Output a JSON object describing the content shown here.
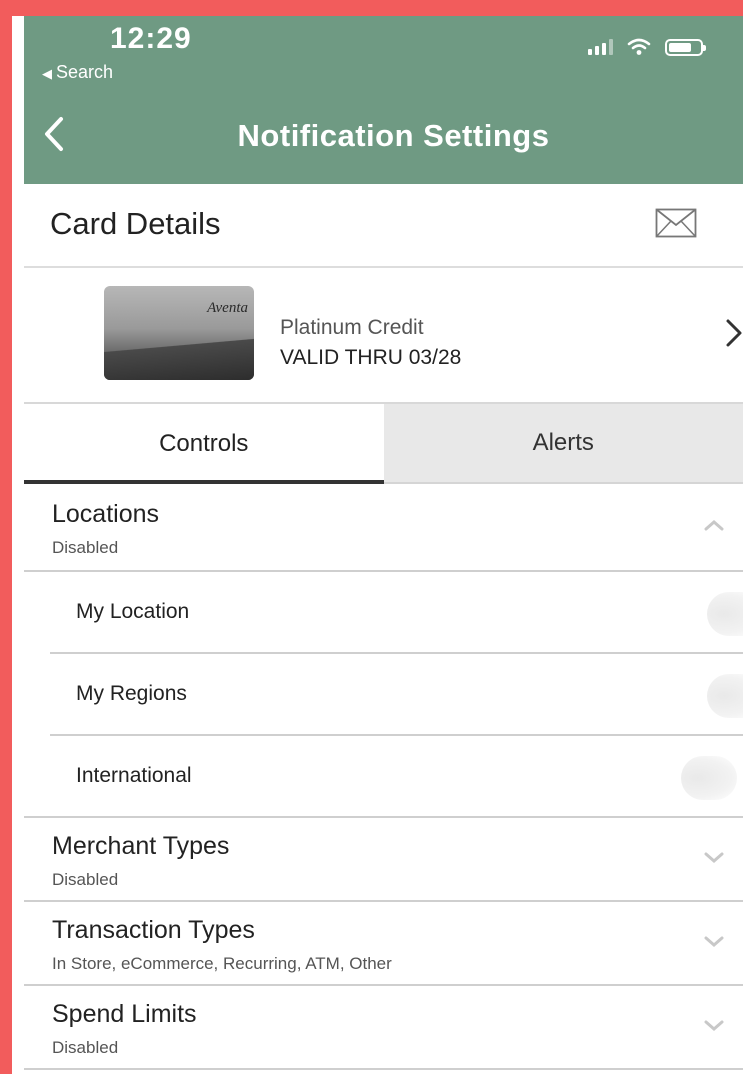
{
  "status_bar": {
    "time": "12:29",
    "back_app": "Search",
    "icons": [
      "signal-icon",
      "wifi-icon",
      "battery-icon"
    ]
  },
  "header": {
    "title": "Notification Settings",
    "back_icon": "chevron-left-icon"
  },
  "card_details": {
    "title": "Card Details",
    "mail_icon": "mail-icon"
  },
  "card": {
    "brand": "Aventa",
    "name": "Platinum Credit",
    "valid_thru": "VALID THRU 03/28"
  },
  "tabs": [
    {
      "label": "Controls",
      "active": true
    },
    {
      "label": "Alerts",
      "active": false
    }
  ],
  "sections": {
    "locations": {
      "title": "Locations",
      "status": "Disabled",
      "expanded": true,
      "items": [
        {
          "label": "My Location"
        },
        {
          "label": "My Regions"
        },
        {
          "label": "International"
        }
      ]
    },
    "merchant_types": {
      "title": "Merchant Types",
      "status": "Disabled"
    },
    "transaction_types": {
      "title": "Transaction Types",
      "status": "In Store, eCommerce, Recurring, ATM, Other"
    },
    "spend_limits": {
      "title": "Spend Limits",
      "status": "Disabled"
    }
  },
  "colors": {
    "header_bg": "#6f9a83",
    "frame": "#f25c5c",
    "inactive_tab": "#e8e8e8"
  }
}
